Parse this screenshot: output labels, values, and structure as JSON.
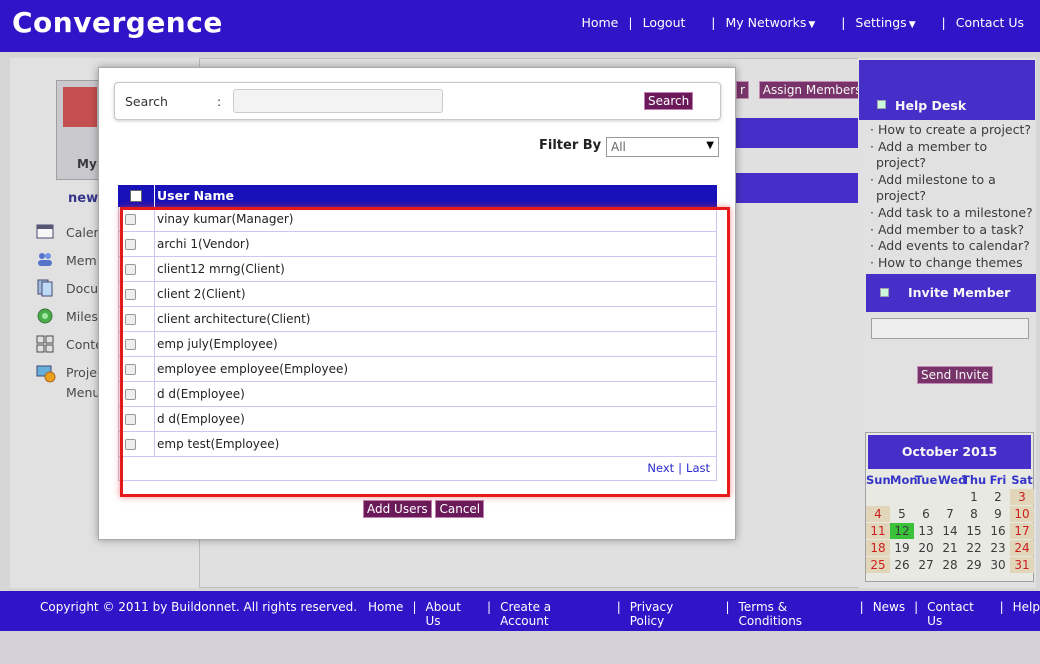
{
  "header": {
    "brand": "Convergence",
    "nav": [
      "Home",
      "Logout",
      "My Networks",
      "Settings",
      "Contact Us"
    ]
  },
  "background": {
    "avatar_label": "My",
    "project_label": "new",
    "left_menu": [
      "Calen",
      "Mem",
      "Docu",
      "Miles",
      "Conte",
      "Proje",
      "Menu"
    ],
    "mid_buttons": [
      "r",
      "Assign Members"
    ]
  },
  "help_desk": {
    "title": "Help Desk",
    "items": [
      "How to create a project?",
      "Add a member to project?",
      "Add milestone to a project?",
      "Add task to a milestone?",
      "Add member to a task?",
      "Add events to calendar?",
      "How to change themes"
    ]
  },
  "invite": {
    "title": "Invite Member",
    "button": "Send Invite"
  },
  "calendar": {
    "title": "October 2015",
    "dow": [
      "Sun",
      "Mon",
      "Tue",
      "Wed",
      "Thu",
      "Fri",
      "Sat"
    ],
    "weeks": [
      [
        "",
        "",
        "",
        "",
        "1",
        "2",
        "3"
      ],
      [
        "4",
        "5",
        "6",
        "7",
        "8",
        "9",
        "10"
      ],
      [
        "11",
        "12",
        "13",
        "14",
        "15",
        "16",
        "17"
      ],
      [
        "18",
        "19",
        "20",
        "21",
        "22",
        "23",
        "24"
      ],
      [
        "25",
        "26",
        "27",
        "28",
        "29",
        "30",
        "31"
      ]
    ],
    "today": "12"
  },
  "footer": {
    "copyright": "Copyright © 2011 by Buildonnet. All rights reserved.",
    "links": [
      "Home",
      "About Us",
      "Create a Account",
      "Privacy Policy",
      "Terms & Conditions",
      "News",
      "Contact Us",
      "Help"
    ]
  },
  "modal": {
    "search_label": "Search",
    "search_colon": ":",
    "search_value": "",
    "search_button": "Search",
    "filter_label": "Filter By :",
    "filter_value": "All",
    "table_header": "User Name",
    "users": [
      "vinay kumar(Manager)",
      "archi 1(Vendor)",
      "client12 mrng(Client)",
      "client 2(Client)",
      "client architecture(Client)",
      "emp july(Employee)",
      "employee employee(Employee)",
      "d d(Employee)",
      "d d(Employee)",
      "emp test(Employee)"
    ],
    "pager_next": "Next",
    "pager_sep": "|",
    "pager_last": "Last",
    "add_button": "Add Users",
    "cancel_button": "Cancel"
  }
}
